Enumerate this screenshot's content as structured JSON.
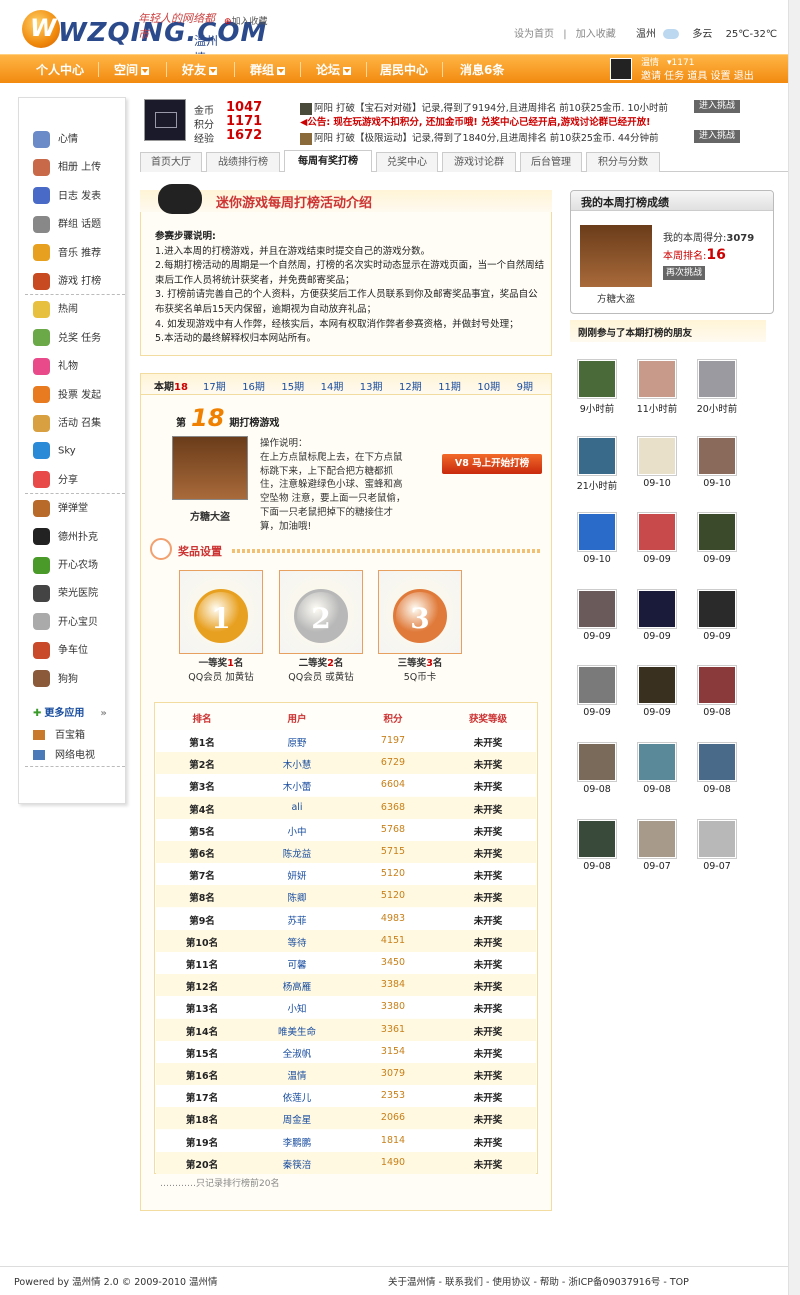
{
  "header": {
    "logo_text": "WZQING.COM",
    "logo_city": "温州情",
    "slogan": "年轻人的网络都市",
    "fav": "加入收藏",
    "set_home": "设为首页",
    "add_fav": "加入收藏",
    "city": "温州",
    "weather": "多云",
    "temp": "25℃-32℃"
  },
  "nav": {
    "items": [
      "个人中心",
      "空间",
      "好友",
      "群组",
      "论坛",
      "居民中心",
      "消息6条"
    ],
    "user_name": "温情",
    "user_coins": "1171",
    "user_links": "邀请 任务 道具 设置 退出"
  },
  "sidebar": {
    "items": [
      "心情",
      "相册 上传",
      "日志 发表",
      "群组 话题",
      "音乐 推荐",
      "游戏 打榜",
      "热闹",
      "兑奖 任务",
      "礼物",
      "投票 发起",
      "活动 召集",
      "Sky",
      "分享",
      "弹弹堂",
      "德州扑克",
      "开心农场",
      "荣光医院",
      "开心宝贝",
      "争车位",
      "狗狗"
    ],
    "more_apps": "更多应用",
    "extra": [
      "百宝箱",
      "网络电视"
    ]
  },
  "profile": {
    "stats": [
      {
        "label": "金币",
        "value": "1047"
      },
      {
        "label": "积分",
        "value": "1171"
      },
      {
        "label": "经验",
        "value": "1672"
      }
    ],
    "feed": [
      {
        "text": "阿阳  打破【宝石对对碰】记录,得到了9194分,且进周排名 前10获25金币.  10小时前",
        "btn": "进入挑战"
      },
      {
        "text": "公告: 现在玩游戏不扣积分, 还加金币哦! 兑奖中心已经开启,游戏讨论群已经开放!",
        "btn": ""
      },
      {
        "text": "阿阳  打破【极限运动】记录,得到了1840分,且进周排名 前10获25金币.  44分钟前",
        "btn": "进入挑战"
      }
    ]
  },
  "tabs": [
    "首页大厅",
    "战绩排行榜",
    "每周有奖打榜",
    "兑奖中心",
    "游戏讨论群",
    "后台管理",
    "积分与分数"
  ],
  "intro": {
    "title": "迷你游戏每周打榜活动介绍",
    "heading": "参赛步骤说明:",
    "lines": [
      "1.进入本周的打榜游戏，并且在游戏结束时提交自己的游戏分数。",
      "2.每期打榜活动的周期是一个自然周，打榜的名次实时动态显示在游戏页面，当一个自然周结束后工作人员将统计获奖者，并免费邮寄奖品；",
      "3. 打榜前请完善自己的个人资料，方便获奖后工作人员联系到你及邮寄奖品事宜，奖品自公布获奖名单后15天内保留，逾期视为自动放弃礼品；",
      "4. 如发现游戏中有人作弊，经核实后，本网有权取消作弊者参赛资格，并做封号处理；",
      "5.本活动的最终解释权归本网站所有。"
    ]
  },
  "periods": {
    "current_label": "本期",
    "current": "18",
    "others": [
      "17期",
      "16期",
      "15期",
      "14期",
      "13期",
      "12期",
      "11期",
      "10期",
      "9期"
    ]
  },
  "game": {
    "prefix": "第",
    "number": "18",
    "suffix": "期打榜游戏",
    "name": "方糖大盗",
    "op_title": "操作说明：",
    "op_text": "在上方点鼠标爬上去，在下方点鼠标跳下来，上下配合把方糖都抓住，注意躲避绿色小球、蜜蜂和高空坠物 注意，要上面一只老鼠偷，下面一只老鼠把掉下的糖接住才算，加油哦!",
    "start_btn": "V8 马上开始打榜"
  },
  "prizes": {
    "title": "奖品设置",
    "items": [
      {
        "rank": "一等奖",
        "count": "1",
        "unit": "名",
        "reward": "QQ会员 加黄钻",
        "num": "1",
        "color": "#e8a020"
      },
      {
        "rank": "二等奖",
        "count": "2",
        "unit": "名",
        "reward": "QQ会员 或黄钻",
        "num": "2",
        "color": "#b8b8b8"
      },
      {
        "rank": "三等奖",
        "count": "3",
        "unit": "名",
        "reward": "5Q币卡",
        "num": "3",
        "color": "#e07a3a"
      }
    ]
  },
  "ranking": {
    "headers": [
      "排名",
      "用户",
      "积分",
      "获奖等级"
    ],
    "rows": [
      [
        "第1名",
        "原野",
        "7197",
        "未开奖"
      ],
      [
        "第2名",
        "木小慧",
        "6729",
        "未开奖"
      ],
      [
        "第3名",
        "木小蕾",
        "6604",
        "未开奖"
      ],
      [
        "第4名",
        "ali",
        "6368",
        "未开奖"
      ],
      [
        "第5名",
        "小中",
        "5768",
        "未开奖"
      ],
      [
        "第6名",
        "陈龙益",
        "5715",
        "未开奖"
      ],
      [
        "第7名",
        "妍妍",
        "5120",
        "未开奖"
      ],
      [
        "第8名",
        "陈卿",
        "5120",
        "未开奖"
      ],
      [
        "第9名",
        "苏菲",
        "4983",
        "未开奖"
      ],
      [
        "第10名",
        "等待",
        "4151",
        "未开奖"
      ],
      [
        "第11名",
        "可馨",
        "3450",
        "未开奖"
      ],
      [
        "第12名",
        "杨高雁",
        "3384",
        "未开奖"
      ],
      [
        "第13名",
        "小知",
        "3380",
        "未开奖"
      ],
      [
        "第14名",
        "唯美生命",
        "3361",
        "未开奖"
      ],
      [
        "第15名",
        "全淑帆",
        "3154",
        "未开奖"
      ],
      [
        "第16名",
        "温情",
        "3079",
        "未开奖"
      ],
      [
        "第17名",
        "依莲儿",
        "2353",
        "未开奖"
      ],
      [
        "第18名",
        "周金星",
        "2066",
        "未开奖"
      ],
      [
        "第19名",
        "李鹏鹏",
        "1814",
        "未开奖"
      ],
      [
        "第20名",
        "秦筷涪",
        "1490",
        "未开奖"
      ]
    ],
    "footer": "…………只记录排行榜前20名"
  },
  "my_score": {
    "title": "我的本周打榜成绩",
    "score_label": "我的本周得分:",
    "score": "3079",
    "rank_label": "本周排名:",
    "rank": "16",
    "retry": "再次挑战",
    "game_name": "方糖大盗"
  },
  "friends": {
    "title": "刚刚参与了本期打榜的朋友",
    "items": [
      {
        "time": "9小时前",
        "color": "#4a6a3a"
      },
      {
        "time": "11小时前",
        "color": "#c89a8a"
      },
      {
        "time": "20小时前",
        "color": "#9a9aa0"
      },
      {
        "time": "21小时前",
        "color": "#3a6a8a"
      },
      {
        "time": "09-10",
        "color": "#e8e0c8"
      },
      {
        "time": "09-10",
        "color": "#8a6a5a"
      },
      {
        "time": "09-10",
        "color": "#2a6ac8"
      },
      {
        "time": "09-09",
        "color": "#c84a4a"
      },
      {
        "time": "09-09",
        "color": "#3a4a2a"
      },
      {
        "time": "09-09",
        "color": "#6a5a5a"
      },
      {
        "time": "09-09",
        "color": "#1a1a3a"
      },
      {
        "time": "09-09",
        "color": "#2a2a2a"
      },
      {
        "time": "09-09",
        "color": "#7a7a7a"
      },
      {
        "time": "09-09",
        "color": "#3a3020"
      },
      {
        "time": "09-08",
        "color": "#8a3a3a"
      },
      {
        "time": "09-08",
        "color": "#7a6a5a"
      },
      {
        "time": "09-08",
        "color": "#5a8a9a"
      },
      {
        "time": "09-08",
        "color": "#4a6a8a"
      },
      {
        "time": "09-08",
        "color": "#3a4a3a"
      },
      {
        "time": "09-07",
        "color": "#a89a8a"
      },
      {
        "time": "09-07",
        "color": "#b8b8b8"
      }
    ]
  },
  "footer": {
    "powered": "Powered by 温州情 2.0 © 2009-2010 温州情",
    "links": "关于温州情 - 联系我们 - 使用协议 - 帮助 - 浙ICP备09037916号 - TOP"
  },
  "colors": {
    "accent": "#f28a0f",
    "link": "#1a4ea0",
    "highlight": "#c00"
  }
}
